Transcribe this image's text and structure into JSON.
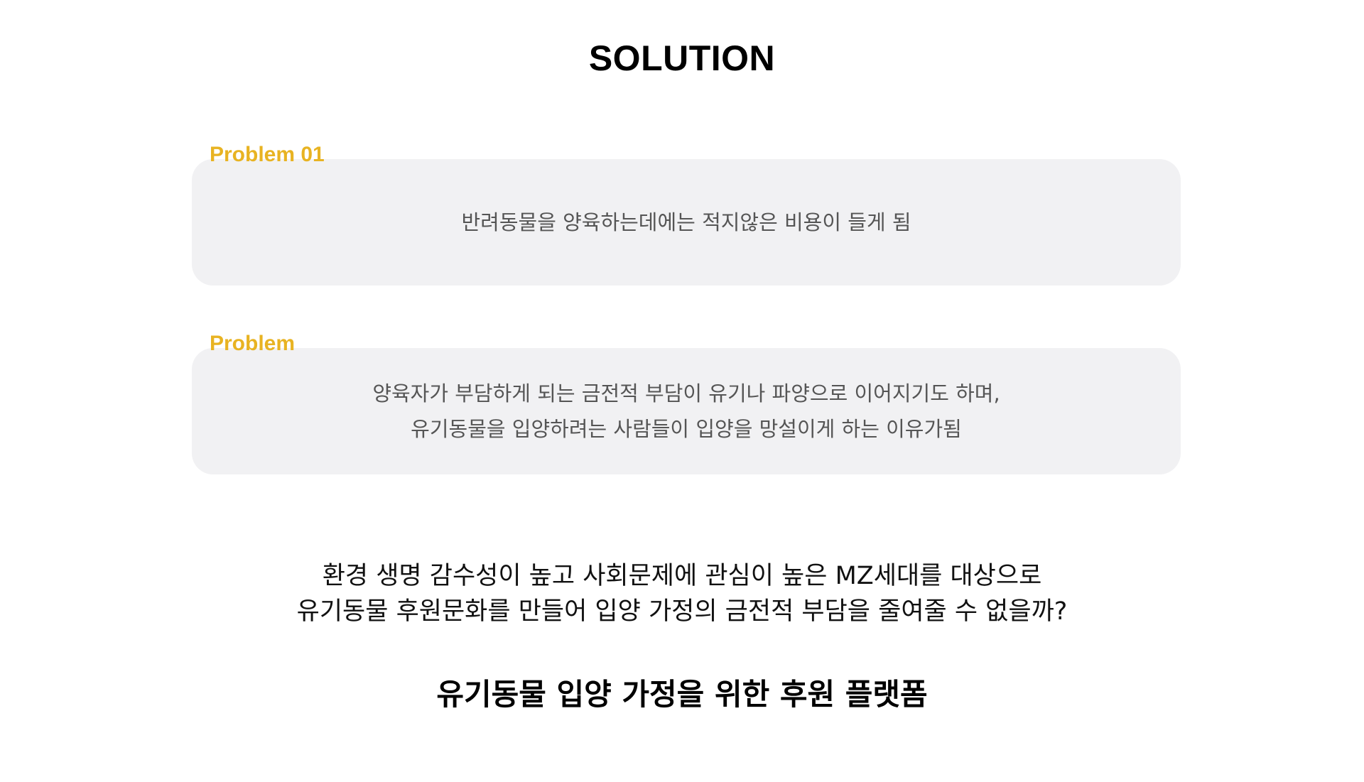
{
  "header": {
    "title": "SOLUTION"
  },
  "problems": [
    {
      "label": "Problem 01",
      "lines": [
        "반려동물을 양육하는데에는 적지않은 비용이 들게 됨"
      ]
    },
    {
      "label": "Problem",
      "lines": [
        "양육자가 부담하게 되는 금전적 부담이 유기나 파양으로 이어지기도 하며,",
        "유기동물을 입양하려는 사람들이 입양을 망설이게 하는 이유가됨"
      ]
    }
  ],
  "question": {
    "lines": [
      "환경 생명 감수성이 높고 사회문제에 관심이 높은 MZ세대를 대상으로",
      "유기동물 후원문화를 만들어 입양 가정의 금전적 부담을 줄여줄 수 없을까?"
    ]
  },
  "conclusion": {
    "text": "유기동물 입양 가정을 위한 후원 플랫폼"
  },
  "colors": {
    "accent": "#e8b322",
    "card_background": "#f1f1f3",
    "body_text": "#555555"
  }
}
